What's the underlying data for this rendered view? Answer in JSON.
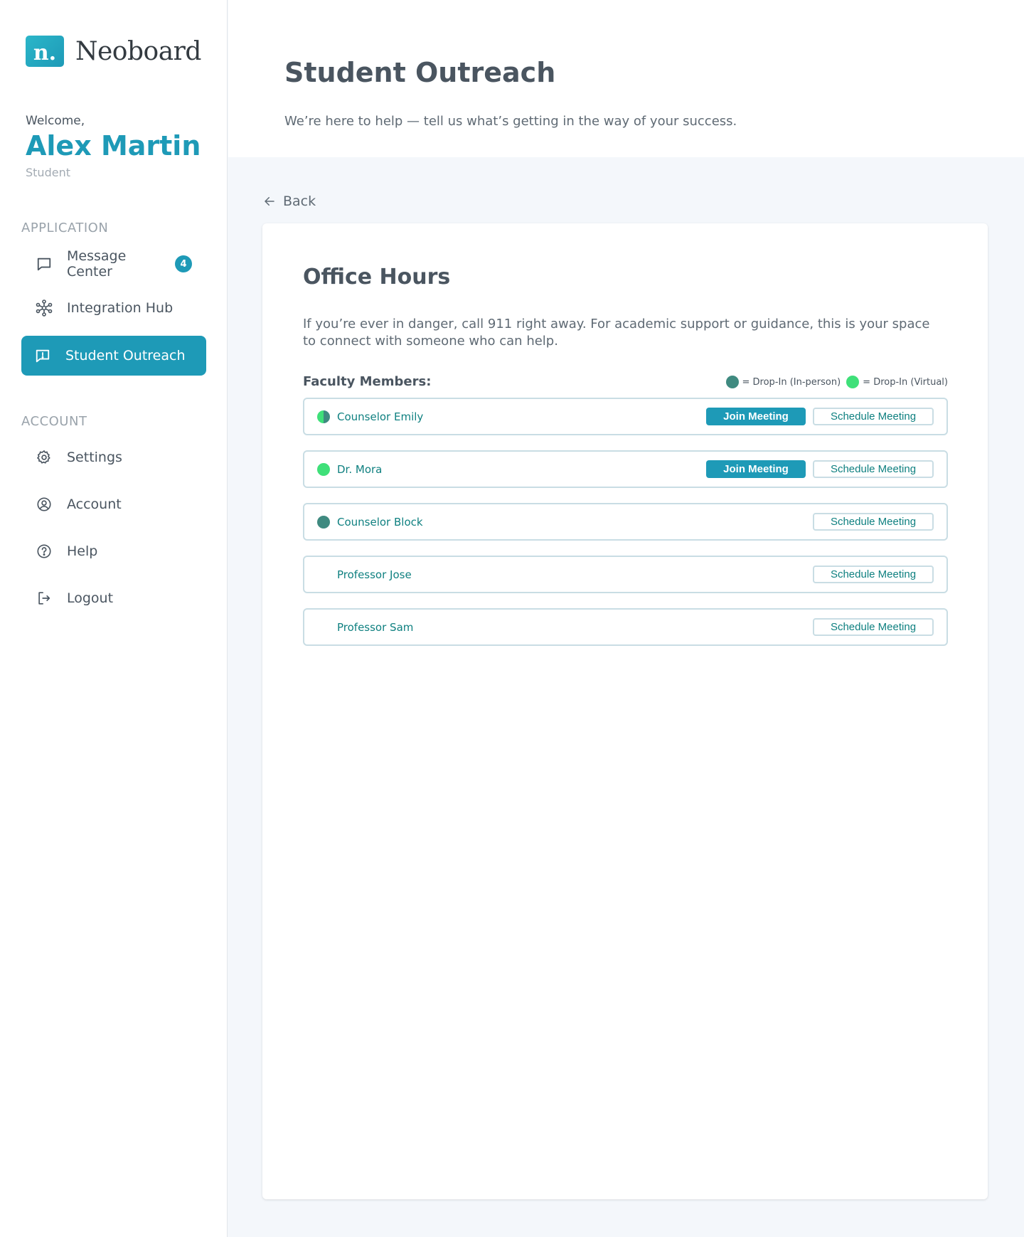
{
  "brand": {
    "name": "Neoboard",
    "mark": "n."
  },
  "user": {
    "welcome": "Welcome,",
    "name": "Alex Martin",
    "role": "Student"
  },
  "sidebar": {
    "application_label": "APPLICATION",
    "application_items": [
      {
        "label": "Message Center",
        "icon": "message-square-icon",
        "badge": "4"
      },
      {
        "label": "Integration Hub",
        "icon": "network-icon"
      },
      {
        "label": "Student Outreach",
        "icon": "message-alert-icon",
        "active": true
      }
    ],
    "account_label": "ACCOUNT",
    "account_items": [
      {
        "label": "Settings",
        "icon": "gear-icon"
      },
      {
        "label": "Account",
        "icon": "user-circle-icon"
      },
      {
        "label": "Help",
        "icon": "help-circle-icon"
      },
      {
        "label": "Logout",
        "icon": "logout-icon"
      }
    ]
  },
  "header": {
    "title": "Student Outreach",
    "subtitle": "We’re here to help — tell us what’s getting in the way of your success."
  },
  "back_label": "Back",
  "office_hours": {
    "title": "Office Hours",
    "description": "If you’re ever in danger, call 911 right away. For academic support or guidance, this is your space to connect with someone who can help.",
    "faculty_label": "Faculty Members:",
    "legend": {
      "in_person": "= Drop-In (In-person)",
      "virtual": "= Drop-In (Virtual)"
    },
    "join_label": "Join Meeting",
    "schedule_label": "Schedule Meeting",
    "faculty": [
      {
        "name": "Counselor Emily",
        "status": "both",
        "can_join": true
      },
      {
        "name": "Dr. Mora",
        "status": "virtual",
        "can_join": true
      },
      {
        "name": "Counselor Block",
        "status": "inperson",
        "can_join": false
      },
      {
        "name": "Professor Jose",
        "status": "none",
        "can_join": false
      },
      {
        "name": "Professor Sam",
        "status": "none",
        "can_join": false
      }
    ]
  },
  "colors": {
    "accent": "#1e9ab7",
    "in_person": "#3f8a80",
    "virtual": "#3fe079",
    "faculty_name": "#0f8080"
  }
}
